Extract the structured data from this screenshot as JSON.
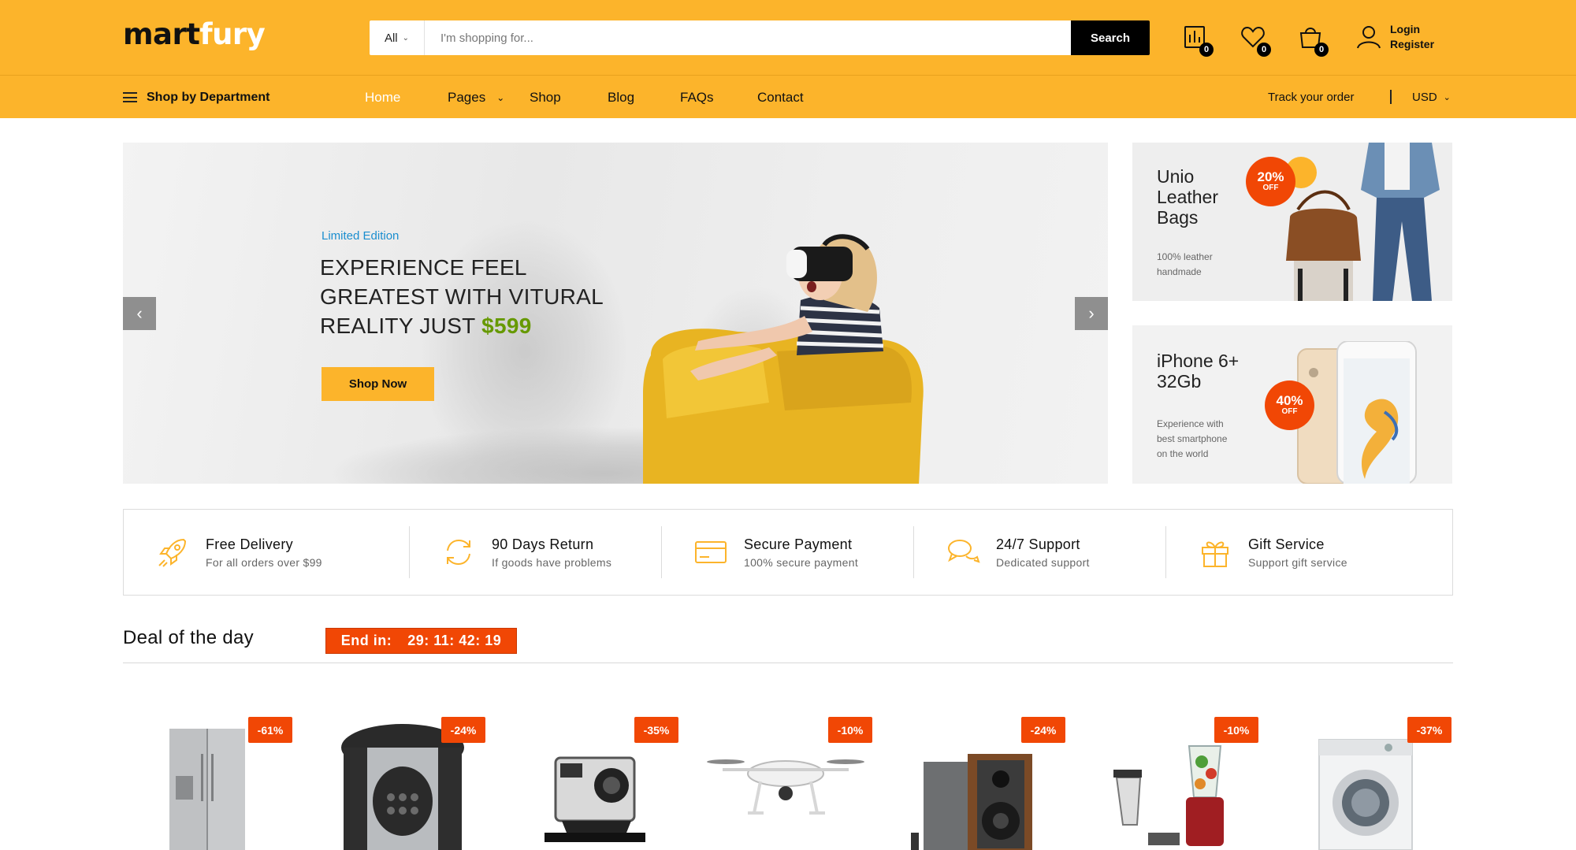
{
  "header": {
    "logo_part1": "mart",
    "logo_part2": "fury",
    "search": {
      "category": "All",
      "placeholder": "I'm shopping for...",
      "button": "Search"
    },
    "compare_count": "0",
    "wishlist_count": "0",
    "cart_count": "0",
    "login": "Login",
    "register": "Register"
  },
  "nav": {
    "department": "Shop by Department",
    "items": [
      "Home",
      "Pages",
      "Shop",
      "Blog",
      "FAQs",
      "Contact"
    ],
    "track": "Track your order",
    "currency": "USD"
  },
  "hero": {
    "kicker": "Limited Edition",
    "line1": "EXPERIENCE FEEL",
    "line2": "GREATEST WITH VITURAL",
    "line3": "REALITY JUST ",
    "price": "$599",
    "button": "Shop Now"
  },
  "banners": [
    {
      "title1": "Unio",
      "title2": "Leather",
      "title3": "Bags",
      "sub1": "100% leather",
      "sub2": "handmade",
      "discount": "20%",
      "off": "OFF"
    },
    {
      "title1": "iPhone 6+",
      "title2": "32Gb",
      "sub1": "Experience with",
      "sub2": "best smartphone",
      "sub3": "on the world",
      "discount": "40%",
      "off": "OFF"
    }
  ],
  "features": [
    {
      "title": "Free Delivery",
      "sub": "For all orders over $99",
      "icon": "rocket-icon"
    },
    {
      "title": "90 Days Return",
      "sub": "If goods have problems",
      "icon": "sync-icon"
    },
    {
      "title": "Secure Payment",
      "sub": "100% secure payment",
      "icon": "credit-card-icon"
    },
    {
      "title": "24/7 Support",
      "sub": "Dedicated support",
      "icon": "chat-icon"
    },
    {
      "title": "Gift Service",
      "sub": "Support gift service",
      "icon": "gift-icon"
    }
  ],
  "deal": {
    "title": "Deal of the day",
    "end_label": "End in:",
    "countdown": "29: 11: 42: 19"
  },
  "products": [
    {
      "discount": "-61%",
      "image": "refrigerator"
    },
    {
      "discount": "-24%",
      "image": "rice-cooker"
    },
    {
      "discount": "-35%",
      "image": "action-camera"
    },
    {
      "discount": "-10%",
      "image": "drone"
    },
    {
      "discount": "-24%",
      "image": "speakers"
    },
    {
      "discount": "-10%",
      "image": "blender"
    },
    {
      "discount": "-37%",
      "image": "washing-machine"
    }
  ],
  "colors": {
    "brand_yellow": "#fcb42b",
    "accent_red": "#f14705",
    "price_green": "#669900",
    "link_blue": "#1b8ecf"
  }
}
